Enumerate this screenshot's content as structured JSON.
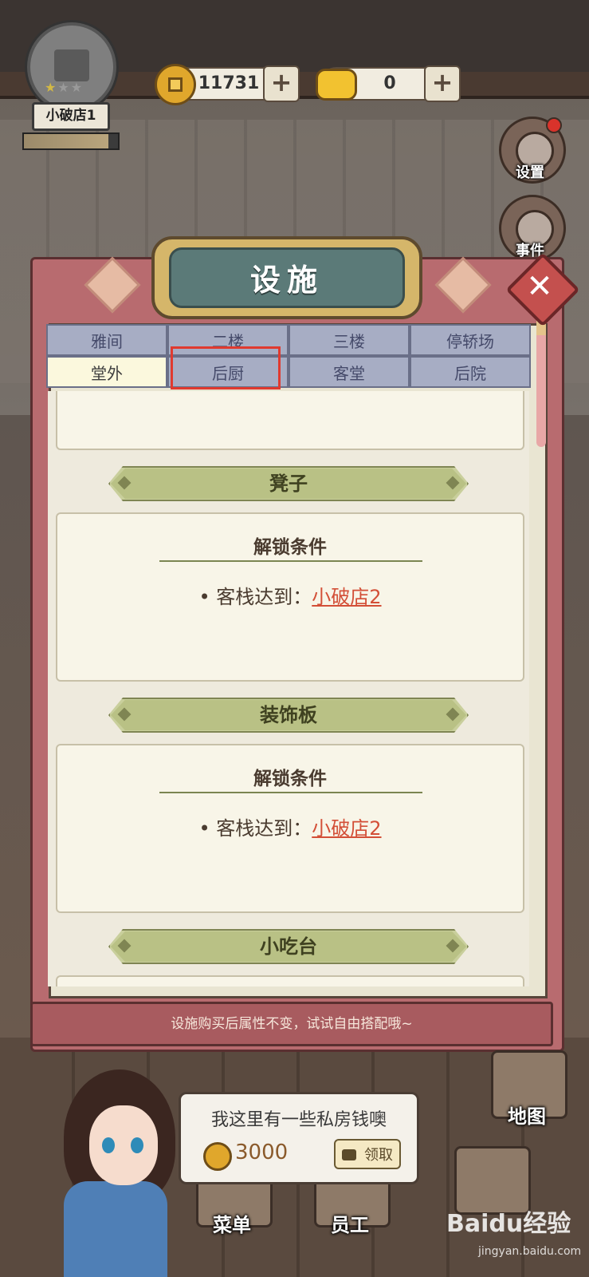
{
  "shop": {
    "name": "小破店1",
    "stars_total": 3,
    "stars_lit": 1,
    "progress": 0.9
  },
  "currency": {
    "coins": "11731",
    "ingots": "0",
    "plus": "+"
  },
  "side": {
    "settings": "设置",
    "events": "事件"
  },
  "panel": {
    "title": "设施",
    "close": "✕",
    "tabs_row1": [
      "雅间",
      "二楼",
      "三楼",
      "停轿场"
    ],
    "tabs_row2": [
      "堂外",
      "后厨",
      "客堂",
      "后院"
    ],
    "active_tab": "堂外",
    "highlighted_tab": "后厨",
    "sections": [
      {
        "title": "凳子",
        "lock_title": "解锁条件",
        "cond_label": "• 客栈达到：",
        "cond_value": "小破店2"
      },
      {
        "title": "装饰板",
        "lock_title": "解锁条件",
        "cond_label": "• 客栈达到：",
        "cond_value": "小破店2"
      },
      {
        "title": "小吃台"
      }
    ],
    "hint": "设施购买后属性不变，试试自由搭配哦~"
  },
  "chat": {
    "text": "我这里有一些私房钱噢",
    "amount": "3000",
    "claim": "领取"
  },
  "bottom": {
    "menu": "菜单",
    "staff": "员工",
    "map": "地图",
    "watermark": "Baidu经验",
    "watermark_sub": "jingyan.baidu.com"
  },
  "colors": {
    "panel": "#b86b6f",
    "tab": "#a7adc4",
    "tab_active": "#fbf8dd",
    "highlight": "#e03a2f",
    "link": "#d34f37"
  }
}
